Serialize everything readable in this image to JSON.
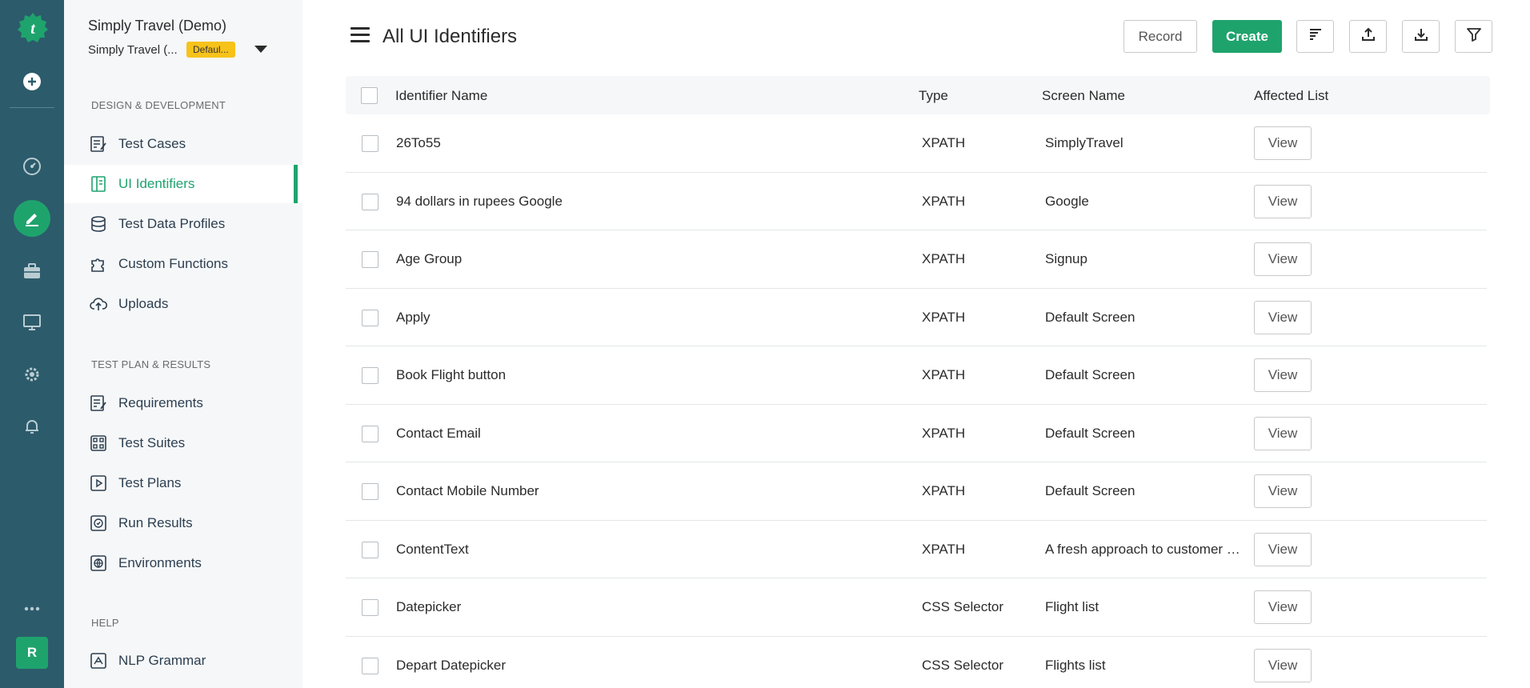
{
  "project": {
    "title": "Simply Travel (Demo)",
    "subtitle": "Simply Travel (...",
    "badge": "Defaul..."
  },
  "rail": {
    "items": [
      "add-icon",
      "dashboard-icon",
      "edit-icon",
      "briefcase-icon",
      "monitor-icon",
      "settings-icon",
      "bell-icon",
      "more-icon"
    ],
    "avatar": "R"
  },
  "nav": {
    "sections": [
      {
        "heading": "DESIGN & DEVELOPMENT",
        "items": [
          {
            "label": "Test Cases",
            "icon": "test-cases-icon"
          },
          {
            "label": "UI Identifiers",
            "icon": "ui-identifiers-icon",
            "active": true
          },
          {
            "label": "Test Data Profiles",
            "icon": "database-icon"
          },
          {
            "label": "Custom Functions",
            "icon": "puzzle-icon"
          },
          {
            "label": "Uploads",
            "icon": "cloud-upload-icon"
          }
        ]
      },
      {
        "heading": "TEST PLAN & RESULTS",
        "items": [
          {
            "label": "Requirements",
            "icon": "requirements-icon"
          },
          {
            "label": "Test Suites",
            "icon": "test-suites-icon"
          },
          {
            "label": "Test Plans",
            "icon": "test-plans-icon"
          },
          {
            "label": "Run Results",
            "icon": "run-results-icon"
          },
          {
            "label": "Environments",
            "icon": "globe-icon"
          }
        ]
      },
      {
        "heading": "HELP",
        "items": [
          {
            "label": "NLP Grammar",
            "icon": "nlp-grammar-icon"
          }
        ]
      }
    ]
  },
  "header": {
    "title": "All UI Identifiers",
    "record_label": "Record",
    "create_label": "Create",
    "icons": [
      "sort-icon",
      "upload-icon",
      "download-icon",
      "filter-icon"
    ]
  },
  "table": {
    "columns": [
      "Identifier Name",
      "Type",
      "Screen Name",
      "Affected List"
    ],
    "view_label": "View",
    "rows": [
      {
        "name": "26To55",
        "type": "XPATH",
        "screen": "SimplyTravel"
      },
      {
        "name": "94 dollars in rupees Google",
        "type": "XPATH",
        "screen": "Google"
      },
      {
        "name": "Age Group",
        "type": "XPATH",
        "screen": "Signup"
      },
      {
        "name": "Apply",
        "type": "XPATH",
        "screen": "Default Screen"
      },
      {
        "name": "Book Flight button",
        "type": "XPATH",
        "screen": "Default Screen"
      },
      {
        "name": "Contact Email",
        "type": "XPATH",
        "screen": "Default Screen"
      },
      {
        "name": "Contact Mobile Number",
        "type": "XPATH",
        "screen": "Default Screen"
      },
      {
        "name": "ContentText",
        "type": "XPATH",
        "screen": "A fresh approach to customer en..."
      },
      {
        "name": "Datepicker",
        "type": "CSS Selector",
        "screen": "Flight list"
      },
      {
        "name": "Depart Datepicker",
        "type": "CSS Selector",
        "screen": "Flights list"
      }
    ]
  },
  "colors": {
    "accent": "#1fa36d",
    "rail": "#2c5b6b",
    "badge": "#f7c21a"
  }
}
